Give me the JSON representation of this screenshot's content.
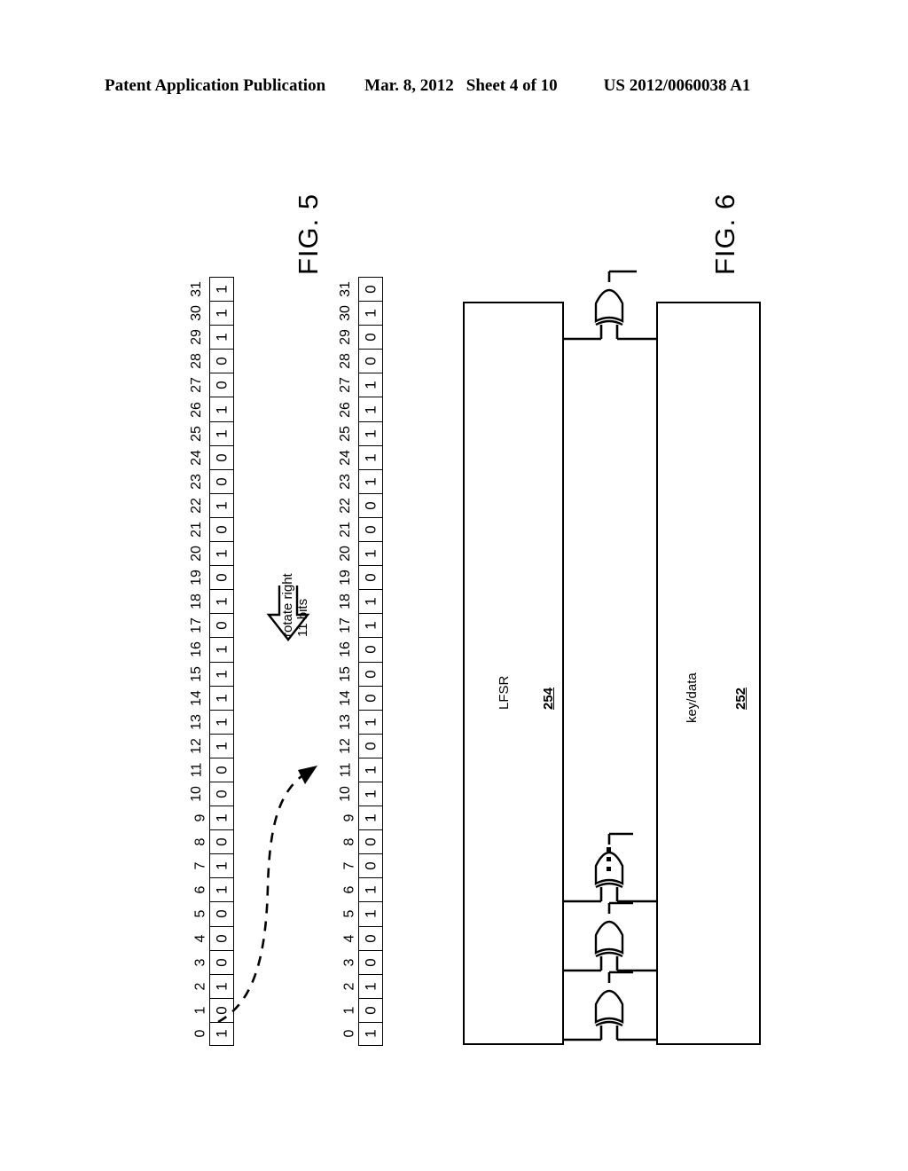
{
  "header": {
    "left": "Patent Application Publication",
    "date": "Mar. 8, 2012",
    "sheet": "Sheet 4 of 10",
    "pubno": "US 2012/0060038 A1"
  },
  "figures": {
    "fig5": {
      "caption": "FIG. 5",
      "indices": [
        0,
        1,
        2,
        3,
        4,
        5,
        6,
        7,
        8,
        9,
        10,
        11,
        12,
        13,
        14,
        15,
        16,
        17,
        18,
        19,
        20,
        21,
        22,
        23,
        24,
        25,
        26,
        27,
        28,
        29,
        30,
        31
      ],
      "before_bits": [
        1,
        0,
        1,
        0,
        0,
        0,
        1,
        1,
        0,
        1,
        0,
        0,
        1,
        1,
        1,
        1,
        1,
        0,
        1,
        0,
        1,
        0,
        1,
        0,
        0,
        1,
        1,
        0,
        0,
        1,
        1,
        1
      ],
      "after_bits": [
        1,
        0,
        1,
        0,
        0,
        1,
        1,
        0,
        0,
        1,
        1,
        1,
        0,
        1,
        0,
        0,
        0,
        1,
        1,
        0,
        1,
        0,
        0,
        1,
        1,
        1,
        1,
        1,
        0,
        0,
        1,
        0
      ],
      "operation_line1": "rotate right",
      "operation_line2": "11 bits",
      "wrap_from_index": 0,
      "wrap_to_index": 11
    },
    "fig6": {
      "caption": "FIG. 6",
      "blocks": [
        {
          "label": "LFSR",
          "number": "254"
        },
        {
          "label": "key/data",
          "number": "252"
        }
      ],
      "gate_type": "xor-gate",
      "gate_count_visible": 4,
      "ellipsis": "vertical-ellipsis"
    }
  }
}
